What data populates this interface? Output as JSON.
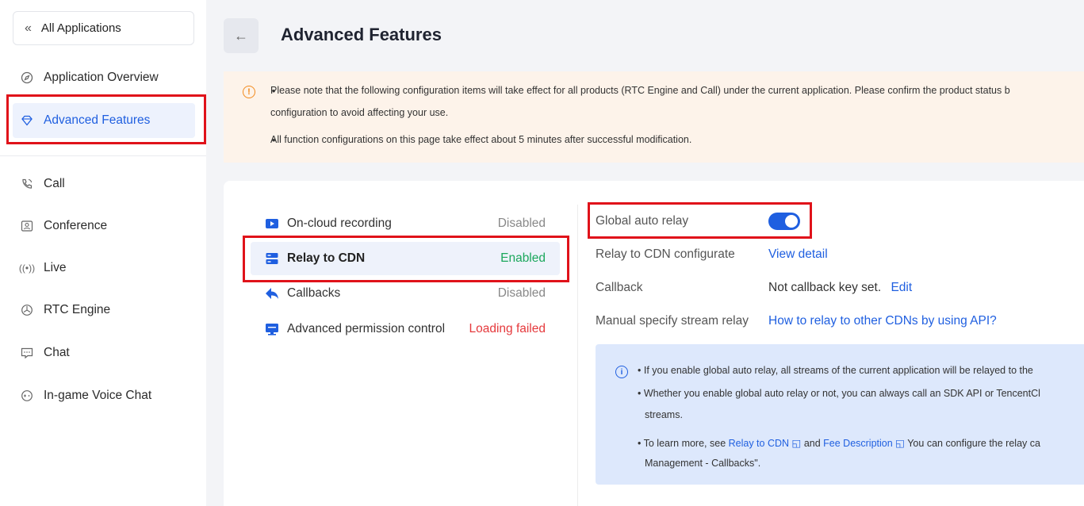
{
  "sidebar": {
    "all_apps": "All Applications",
    "items": [
      {
        "label": "Application Overview",
        "icon": "compass-icon"
      },
      {
        "label": "Advanced Features",
        "icon": "diamond-icon"
      },
      {
        "label": "Call",
        "icon": "phone-icon"
      },
      {
        "label": "Conference",
        "icon": "conference-icon"
      },
      {
        "label": "Live",
        "icon": "broadcast-icon"
      },
      {
        "label": "RTC Engine",
        "icon": "engine-icon"
      },
      {
        "label": "Chat",
        "icon": "chat-icon"
      },
      {
        "label": "In-game Voice Chat",
        "icon": "gamepad-icon"
      }
    ]
  },
  "header": {
    "title": "Advanced Features"
  },
  "notice": {
    "line1": "Please note that the following configuration items will take effect for all products (RTC Engine and Call) under the current application. Please confirm the product status b",
    "line1b": "configuration to avoid affecting your use.",
    "line2": "All function configurations on this page take effect about 5 minutes after successful modification."
  },
  "features": [
    {
      "label": "On-cloud recording",
      "status": "Disabled"
    },
    {
      "label": "Relay to CDN",
      "status": "Enabled"
    },
    {
      "label": "Callbacks",
      "status": "Disabled"
    },
    {
      "label": "Advanced permission control",
      "status": "Loading failed"
    }
  ],
  "detail": {
    "global_auto_relay_label": "Global auto relay",
    "global_auto_relay_on": true,
    "configurate_label": "Relay to CDN configurate",
    "view_detail": "View detail",
    "callback_label": "Callback",
    "callback_value": "Not callback key set.",
    "edit": "Edit",
    "manual_label": "Manual specify stream relay",
    "manual_link": "How to relay to other CDNs by using API?"
  },
  "info": {
    "b1": "If you enable global auto relay, all streams of the current application will be relayed to the",
    "b2": "Whether you enable global auto relay or not, you can always call an SDK API or TencentCl",
    "b2b": "streams.",
    "b3_pre": "To learn more, see ",
    "b3_link1": "Relay to CDN",
    "b3_mid": " and ",
    "b3_link2": "Fee Description",
    "b3_post": " You can configure the relay ca",
    "b3b": "Management - Callbacks\"."
  },
  "colors": {
    "accent": "#1f5fe0",
    "enabled": "#1ba75c",
    "error": "#e5393c",
    "highlight_box": "#e0121a"
  }
}
